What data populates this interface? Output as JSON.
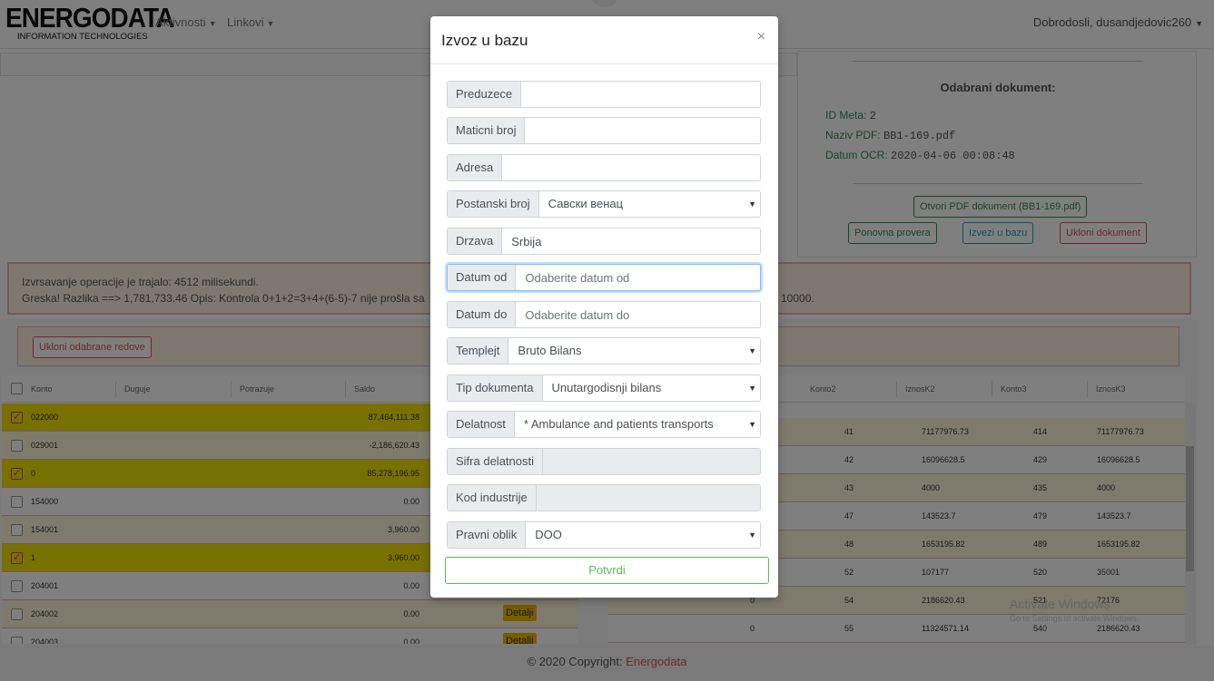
{
  "navbar": {
    "logo_main": "ENERGODATA",
    "logo_sub": "INFORMATION TECHNOLOGIES",
    "menu_aktivnosti": "Aktivnosti",
    "menu_linkovi": "Linkovi",
    "user": "Dobrodosli, dusandjedovic260"
  },
  "document": {
    "title": "Odabrani dokument:",
    "id_label": "ID Meta:",
    "id_value": "2",
    "pdf_label": "Naziv PDF:",
    "pdf_value": "BB1-169.pdf",
    "ocr_label": "Datum OCR:",
    "ocr_value": "2020-04-06 00:08:48",
    "open_btn": "Otvori PDF dokument (BB1-169.pdf)",
    "recheck_btn": "Ponovna provera",
    "export_btn": "Izvezi u bazu",
    "remove_btn": "Ukloni dokument"
  },
  "alert": {
    "line1": "Izvrsavanje operacije je trajalo: 4512 milisekundi.",
    "line2": "Greska! Razlika ==> 1,781,733.46 Opis: Kontrola 0+1+2=3+4+(6-5)-7 nije prošla sa",
    "line2_tail": "d 10000."
  },
  "actions": {
    "remove_selected": "Ukloni odabrane redove"
  },
  "left_table": {
    "headers": [
      "Konto",
      "Duguje",
      "Potrazuje",
      "Saldo"
    ],
    "rows": [
      {
        "konto": "022000",
        "saldo": "87,464,111.38",
        "checked": true,
        "color": "yellow"
      },
      {
        "konto": "029001",
        "saldo": "-2,186,620.43",
        "checked": false,
        "color": "pale"
      },
      {
        "konto": "0",
        "saldo": "85,278,196.95",
        "checked": true,
        "color": "yellow"
      },
      {
        "konto": "154000",
        "saldo": "0.00",
        "checked": false,
        "color": "white"
      },
      {
        "konto": "154001",
        "saldo": "3,960.00",
        "checked": false,
        "color": "pale"
      },
      {
        "konto": "1",
        "saldo": "3,960.00",
        "checked": true,
        "color": "yellow"
      },
      {
        "konto": "204001",
        "saldo": "0.00",
        "checked": false,
        "color": "white"
      },
      {
        "konto": "204002",
        "saldo": "0.00",
        "checked": false,
        "color": "pale"
      },
      {
        "konto": "204003",
        "saldo": "0.00",
        "checked": false,
        "color": "white"
      }
    ],
    "detail_label": "Detalji"
  },
  "right_table": {
    "headers": [
      "Konto2",
      "IznosK2",
      "Konto3",
      "IznosK3"
    ],
    "rows": [
      {
        "a": "",
        "k2": "41",
        "i2": "71177976.73",
        "k3": "414",
        "i3": "71177976.73",
        "color": "pale"
      },
      {
        "a": "",
        "k2": "42",
        "i2": "16096628.5",
        "k3": "429",
        "i3": "16096628.5",
        "color": "white"
      },
      {
        "a": "",
        "k2": "43",
        "i2": "4000",
        "k3": "435",
        "i3": "4000",
        "color": "pale"
      },
      {
        "a": "",
        "k2": "47",
        "i2": "143523.7",
        "k3": "479",
        "i3": "143523.7",
        "color": "white"
      },
      {
        "a": "",
        "k2": "48",
        "i2": "1653195.82",
        "k3": "489",
        "i3": "1653195.82",
        "color": "pale"
      },
      {
        "a": "",
        "k2": "52",
        "i2": "107177",
        "k3": "520",
        "i3": "35001",
        "color": "white"
      },
      {
        "a": "0",
        "k2": "54",
        "i2": "2186620.43",
        "k3": "521",
        "i3": "72176",
        "color": "pale"
      },
      {
        "a": "0",
        "k2": "55",
        "i2": "11324571.14",
        "k3": "540",
        "i3": "2186620.43",
        "color": "white"
      }
    ]
  },
  "watermark": {
    "line1": "Activate Windows",
    "line2": "Go to Settings to activate Windows."
  },
  "footer": {
    "text": "© 2020 Copyright: ",
    "brand": "Energodata"
  },
  "modal": {
    "title": "Izvoz u bazu",
    "close": "×",
    "fields": {
      "preduzece": {
        "label": "Preduzece",
        "value": ""
      },
      "maticni": {
        "label": "Maticni broj",
        "value": ""
      },
      "adresa": {
        "label": "Adresa",
        "value": ""
      },
      "postanski": {
        "label": "Postanski broj",
        "value": "Савски венац"
      },
      "drzava": {
        "label": "Drzava",
        "value": "Srbija"
      },
      "datum_od": {
        "label": "Datum od",
        "placeholder": "Odaberite datum od"
      },
      "datum_do": {
        "label": "Datum do",
        "placeholder": "Odaberite datum do"
      },
      "templejt": {
        "label": "Templejt",
        "value": "Bruto Bilans"
      },
      "tip": {
        "label": "Tip dokumenta",
        "value": "Unutargodisnji bilans"
      },
      "delatnost": {
        "label": "Delatnost",
        "value": "* Ambulance and patients transports"
      },
      "sifra": {
        "label": "Sifra delatnosti",
        "value": ""
      },
      "kod": {
        "label": "Kod industrije",
        "value": ""
      },
      "pravni": {
        "label": "Pravni oblik",
        "value": "DOO"
      }
    },
    "submit": "Potvrdi"
  }
}
